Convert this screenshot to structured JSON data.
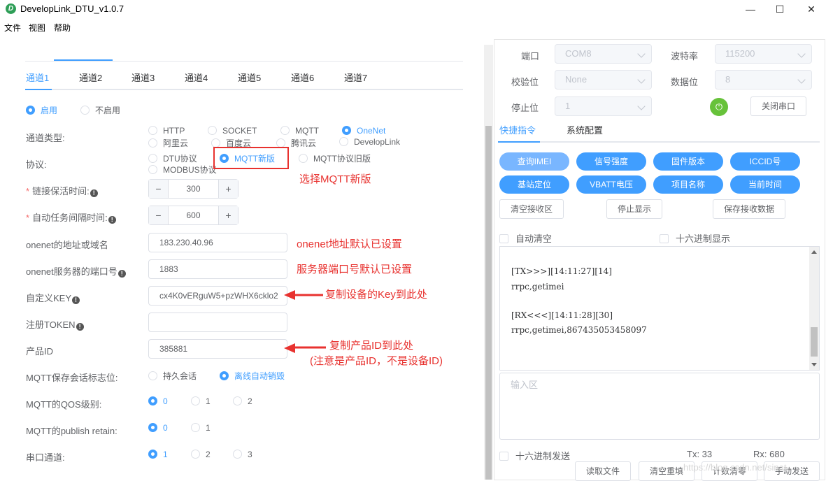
{
  "window": {
    "title": "DevelopLink_DTU_v1.0.7",
    "minimize": "—",
    "maximize": "☐",
    "close": "✕"
  },
  "menu": [
    "文件",
    "视图",
    "帮助"
  ],
  "channel_tabs": [
    "通道1",
    "通道2",
    "通道3",
    "通道4",
    "通道5",
    "通道6",
    "通道7"
  ],
  "form": {
    "enable_on": "启用",
    "enable_off": "不启用",
    "channel_type_label": "通道类型:",
    "channel_types_row1": [
      "HTTP",
      "SOCKET",
      "MQTT",
      "OneNet"
    ],
    "channel_types_row2": [
      "阿里云",
      "百度云",
      "腾讯云",
      "DevelopLink"
    ],
    "protocol_label": "协议:",
    "protocols": [
      "DTU协议",
      "MQTT新版",
      "MQTT协议旧版",
      "MODBUS协议"
    ],
    "keepalive_label": "链接保活时间:",
    "keepalive_value": "300",
    "task_interval_label": "自动任务间隔时间:",
    "task_interval_value": "600",
    "onenet_addr_label": "onenet的地址或域名",
    "onenet_addr_value": "183.230.40.96",
    "onenet_port_label": "onenet服务器的端口号",
    "onenet_port_value": "1883",
    "custom_key_label": "自定义KEY",
    "custom_key_value": "cx4K0vERguW5+pzWHX6cklo2",
    "token_label": "注册TOKEN",
    "token_value": "",
    "product_id_label": "产品ID",
    "product_id_value": "385881",
    "session_label": "MQTT保存会话标志位:",
    "session_options": [
      "持久会话",
      "离线自动销毁"
    ],
    "qos_label": "MQTT的QOS级别:",
    "qos_options": [
      "0",
      "1",
      "2"
    ],
    "retain_label": "MQTT的publish retain:",
    "retain_options": [
      "0",
      "1"
    ],
    "serial_label": "串口通道:",
    "serial_options": [
      "1",
      "2",
      "3"
    ]
  },
  "annotations": {
    "protocol": "选择MQTT新版",
    "addr": "onenet地址默认已设置",
    "port": "服务器端口号默认已设置",
    "key": "复制设备的Key到此处",
    "product_line1": "复制产品ID到此处",
    "product_line2": "(注意是产品ID，不是设备ID)"
  },
  "serial": {
    "port_label": "端口",
    "port_value": "COM8",
    "baud_label": "波特率",
    "baud_value": "115200",
    "parity_label": "校验位",
    "parity_value": "None",
    "databits_label": "数据位",
    "databits_value": "8",
    "stopbits_label": "停止位",
    "stopbits_value": "1",
    "close_button": "关闭串口",
    "power_glyph": "⏻"
  },
  "right_tabs": [
    "快捷指令",
    "系统配置"
  ],
  "quick_commands": [
    "查询IMEI",
    "信号强度",
    "固件版本",
    "ICCID号",
    "基站定位",
    "VBATT电压",
    "项目名称",
    "当前时间"
  ],
  "actions": [
    "清空接收区",
    "停止显示",
    "保存接收数据"
  ],
  "checks": {
    "auto_clear": "自动清空",
    "hex_display": "十六进制显示",
    "hex_send": "十六进制发送"
  },
  "log": [
    "[TX>>>][14:11:27][14]",
    "rrpc,getimei",
    "[RX<<<][14:11:28][30]",
    "rrpc,getimei,867435053458097"
  ],
  "input_placeholder": "输入区",
  "counters": {
    "tx": "Tx: 33",
    "rx": "Rx: 680"
  },
  "bottom_buttons": [
    "读取文件",
    "清空重填",
    "计数清零",
    "手动发送"
  ],
  "watermark": "https://blog.csdn.net/sinat_"
}
